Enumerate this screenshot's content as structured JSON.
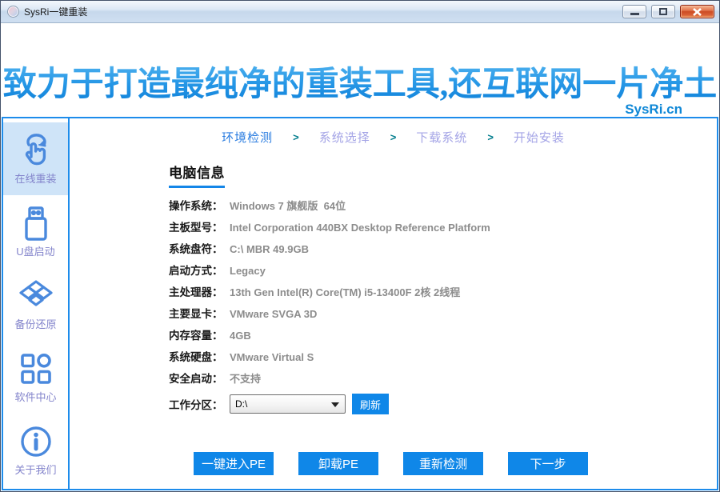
{
  "window": {
    "title": "SysRi一键重装"
  },
  "header": {
    "slogan": "致力于打造最纯净的重装工具,还互联网一片净土",
    "site_label": "SysRi.cn"
  },
  "sidebar": {
    "items": [
      {
        "label": "在线重装",
        "icon": "online-reinstall-icon",
        "active": true
      },
      {
        "label": "U盘启动",
        "icon": "usb-boot-icon",
        "active": false
      },
      {
        "label": "备份还原",
        "icon": "backup-restore-icon",
        "active": false
      },
      {
        "label": "软件中心",
        "icon": "software-center-icon",
        "active": false
      },
      {
        "label": "关于我们",
        "icon": "about-us-icon",
        "active": false
      }
    ]
  },
  "steps": {
    "separator": ">",
    "items": [
      {
        "label": "环境检测",
        "active": true
      },
      {
        "label": "系统选择",
        "active": false
      },
      {
        "label": "下载系统",
        "active": false
      },
      {
        "label": "开始安装",
        "active": false
      }
    ]
  },
  "computer_info": {
    "section_title": "电脑信息",
    "rows": [
      {
        "label": "操作系统：",
        "value": "Windows 7 旗舰版  64位"
      },
      {
        "label": "主板型号：",
        "value": "Intel Corporation 440BX Desktop Reference Platform"
      },
      {
        "label": "系统盘符：",
        "value": "C:\\ MBR 49.9GB"
      },
      {
        "label": "启动方式：",
        "value": "Legacy"
      },
      {
        "label": "主处理器：",
        "value": "13th Gen Intel(R) Core(TM) i5-13400F 2核 2线程"
      },
      {
        "label": "主要显卡：",
        "value": "VMware SVGA 3D"
      },
      {
        "label": "内存容量：",
        "value": "4GB"
      },
      {
        "label": "系统硬盘：",
        "value": "VMware Virtual S"
      },
      {
        "label": "安全启动：",
        "value": "不支持"
      }
    ],
    "work_partition": {
      "label": "工作分区：",
      "selected_value": "D:\\",
      "refresh_button": "刷新"
    }
  },
  "actions": {
    "buttons": [
      {
        "label": "一键进入PE"
      },
      {
        "label": "卸载PE"
      },
      {
        "label": "重新检测"
      },
      {
        "label": "下一步"
      }
    ]
  },
  "colors": {
    "accent_blue": "#0f87e8",
    "border_blue": "#1d8ceb",
    "icon_blue": "#4a89dd",
    "selected_bg": "#cfe4f8",
    "step_inactive": "#a4a4e6",
    "step_separator_teal": "#007c8c",
    "value_gray": "#8c8c8c"
  }
}
